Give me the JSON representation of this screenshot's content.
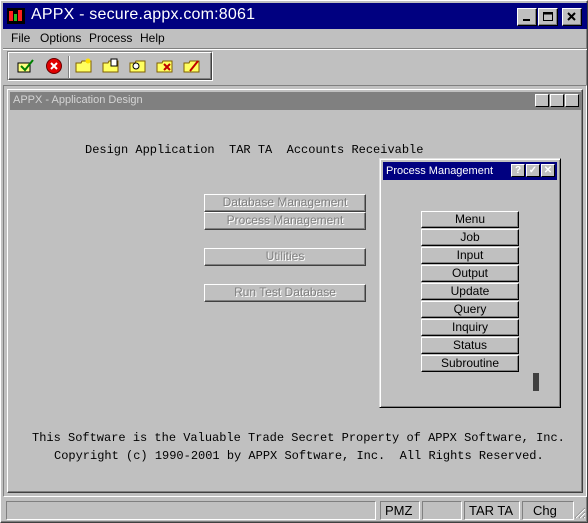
{
  "window": {
    "title": "APPX - secure.appx.com:8061",
    "controls": [
      "minimize",
      "maximize",
      "close"
    ]
  },
  "menu": [
    "File",
    "Options",
    "Process",
    "Help"
  ],
  "toolbar": {
    "icons": [
      "check-icon",
      "cancel-icon",
      "folder-new-icon",
      "folder-open-icon",
      "folder-search-icon",
      "folder-delete-icon",
      "folder-edit-icon"
    ]
  },
  "child_window": {
    "title": "APPX - Application Design",
    "controls": [
      "?",
      "✓",
      "✕"
    ],
    "header": "Design Application  TAR TA  Accounts Receivable",
    "buttons": [
      "Database Management",
      "Process Management",
      "Utilities",
      "Run Test Database"
    ],
    "footer_line1": "This Software is the Valuable Trade Secret Property of APPX Software, Inc.",
    "footer_line2": "Copyright (c) 1990-2001 by APPX Software, Inc.  All Rights Reserved."
  },
  "popup": {
    "title": "Process Management",
    "controls": [
      "?",
      "✓",
      "✕"
    ],
    "items": [
      "Menu",
      "Job",
      "Input",
      "Output",
      "Update",
      "Query",
      "Inquiry",
      "Status",
      "Subroutine"
    ]
  },
  "statusbar": {
    "fields": [
      "",
      "PMZ",
      "",
      "TAR TA",
      "Chg"
    ]
  },
  "colors": {
    "titlebar": "#000080",
    "inactive_title": "#808080",
    "face": "#c0c0c0"
  }
}
